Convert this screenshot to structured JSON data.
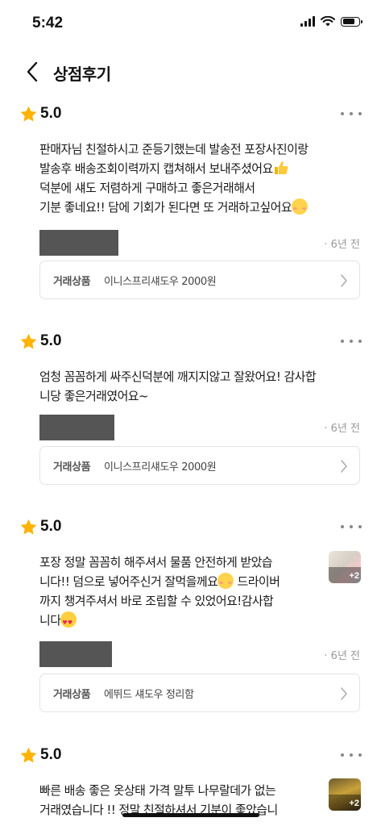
{
  "status_bar": {
    "time": "5:42",
    "battery_level": 0.8
  },
  "header": {
    "title": "상점후기",
    "back_icon": "chevron-left-icon"
  },
  "product_label_text": "거래상품",
  "reviews": [
    {
      "rating": "5.0",
      "lines": [
        "판매자님 친절하시고 준등기했는데 발송전 포장사진이랑",
        "발송후 배송조회이력까지 캡쳐해서 보내주셨어요",
        "덕분에 섀도 저렴하게 구매하고 좋은거래해서",
        "기분 좋네요!! 담에 기회가 된다면 또 거래하고싶어요"
      ],
      "time_ago": "· 6년 전",
      "product": "이니스프리섀도우 2000원"
    },
    {
      "rating": "5.0",
      "lines": [
        "엄청 꼼꼼하게 싸주신덕분에 깨지지않고 잘왔어요! 감사합",
        "니당 좋은거래였어요~"
      ],
      "time_ago": "· 6년 전",
      "product": "이니스프리섀도우 2000원"
    },
    {
      "rating": "5.0",
      "lines": [
        "포장 정말 꼼꼼히 해주셔서 물품 안전하게 받았습",
        "니다!! 덤으로 넣어주신거 잘먹을께요",
        " 드라이버",
        "까지 챙겨주셔서 바로 조립할 수 있었어요!감사합",
        "니다"
      ],
      "time_ago": "· 6년 전",
      "product": "에뛰드 섀도우 정리함",
      "photo_more": "+2"
    },
    {
      "rating": "5.0",
      "lines": [
        "빠른 배송 좋은 옷상태 가격 말투 나무랄데가 없는",
        "거래였습니다 !! 정말 친절하셔서 기분이 좋았습니"
      ],
      "photo_more": "+2"
    }
  ],
  "colors": {
    "star": "#FFB300",
    "text": "#1A1A1A",
    "muted": "#999999",
    "mask": "#555555",
    "border": "#E3E3E3"
  }
}
